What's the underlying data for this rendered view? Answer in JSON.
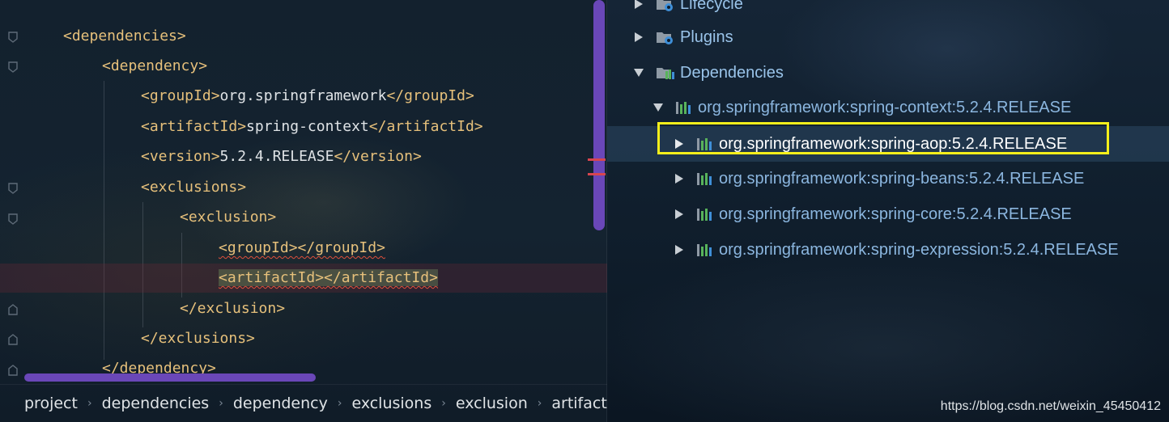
{
  "editor": {
    "lines": [
      {
        "open": "<dependencies>"
      },
      {
        "open": "<dependency>"
      },
      {
        "open": "<groupId>",
        "text": "org.springframework",
        "close": "</groupId>"
      },
      {
        "open": "<artifactId>",
        "text": "spring-context",
        "close": "</artifactId>"
      },
      {
        "open": "<version>",
        "text": "5.2.4.RELEASE",
        "close": "</version>"
      },
      {
        "open": "<exclusions>"
      },
      {
        "open": "<exclusion>"
      },
      {
        "open": "<groupId>",
        "close": "</groupId>"
      },
      {
        "open": "<artifactId>",
        "close": "</artifactId>"
      },
      {
        "close": "</exclusion>"
      },
      {
        "close": "</exclusions>"
      },
      {
        "close": "</dependency>"
      }
    ]
  },
  "breadcrumb": {
    "items": [
      "project",
      "dependencies",
      "dependency",
      "exclusions",
      "exclusion",
      "artifact"
    ],
    "separator": "›"
  },
  "maven_tree": {
    "lifecycle": "Lifecycle",
    "plugins": "Plugins",
    "dependencies": "Dependencies",
    "root_dependency": "org.springframework:spring-context:5.2.4.RELEASE",
    "children": [
      "org.springframework:spring-aop:5.2.4.RELEASE",
      "org.springframework:spring-beans:5.2.4.RELEASE",
      "org.springframework:spring-core:5.2.4.RELEASE",
      "org.springframework:spring-expression:5.2.4.RELEASE"
    ]
  },
  "watermark": "https://blog.csdn.net/weixin_45450412",
  "colors": {
    "tag": "#e6c07b",
    "text": "#dfe3e6",
    "scrollbar": "#6a47b8",
    "highlight_box": "#f5ef1b",
    "error_marker": "#d8454f"
  }
}
